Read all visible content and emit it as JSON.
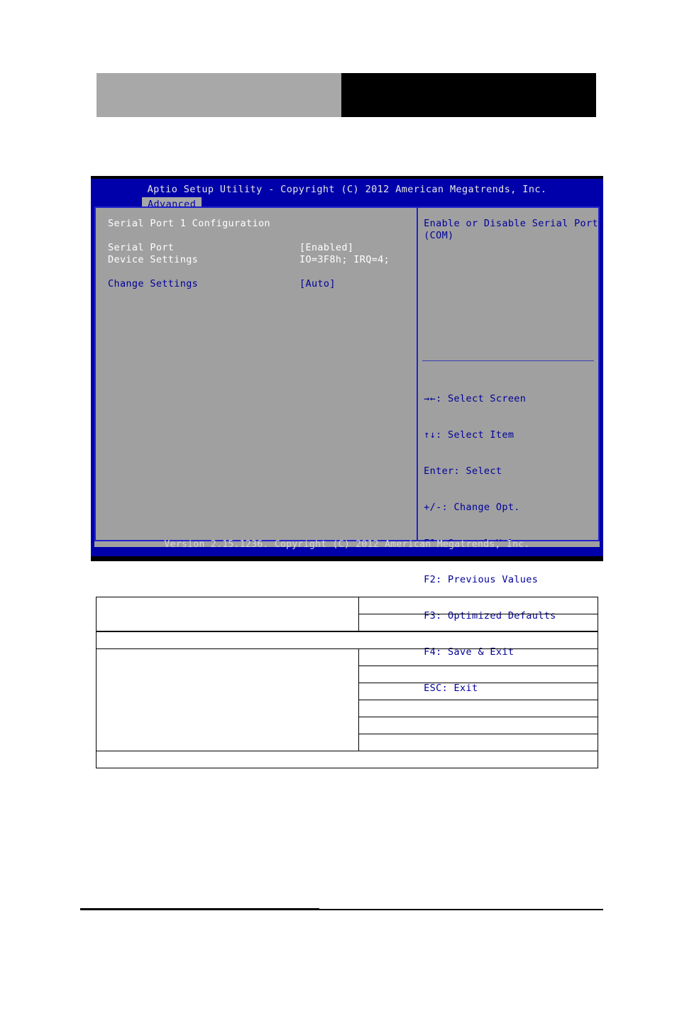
{
  "page": {
    "header_blocks": [
      {
        "name": "left-block",
        "color": "#a8a8a8",
        "text": ""
      },
      {
        "name": "right-block",
        "color": "#000000",
        "text": ""
      }
    ]
  },
  "bios": {
    "title": "Aptio Setup Utility - Copyright (C) 2012 American Megatrends, Inc.",
    "tabs": [
      {
        "label": "Advanced",
        "active": true
      }
    ],
    "section_title": "Serial Port 1 Configuration",
    "settings": [
      {
        "label": "Serial Port",
        "value": "[Enabled]",
        "style": "white",
        "selected": true
      },
      {
        "label": "Device Settings",
        "value": "IO=3F8h; IRQ=4;",
        "style": "white",
        "selected": false
      },
      {
        "label": "",
        "value": "",
        "style": "spacer",
        "selected": false
      },
      {
        "label": "Change Settings",
        "value": "[Auto]",
        "style": "blue",
        "selected": false
      }
    ],
    "help": {
      "line1": "Enable or Disable Serial Port",
      "line2": "(COM)"
    },
    "keys": [
      "→←: Select Screen",
      "↑↓: Select Item",
      "Enter: Select",
      "+/-: Change Opt.",
      "F1: General Help",
      "F2: Previous Values",
      "F3: Optimized Defaults",
      "F4: Save & Exit",
      "ESC: Exit"
    ],
    "footer": "Version 2.15.1236. Copyright (C) 2012 American Megatrends, Inc.",
    "colors": {
      "screen_blue": "#0000aa",
      "panel_gray": "#a0a0a0",
      "border_blue": "#2222cc",
      "text_white": "#ffffff",
      "text_blue": "#000099"
    }
  },
  "spec_table": {
    "rows": [
      {
        "cells": [
          "",
          ""
        ]
      },
      {
        "cells": [
          "",
          ""
        ]
      },
      {
        "cells": [
          ""
        ],
        "span": 2
      },
      {
        "cells": [
          "",
          ""
        ]
      },
      {
        "cells": [
          "",
          ""
        ]
      },
      {
        "cells": [
          "",
          ""
        ]
      },
      {
        "cells": [
          "",
          ""
        ]
      },
      {
        "cells": [
          "",
          ""
        ]
      },
      {
        "cells": [
          "",
          ""
        ]
      },
      {
        "cells": [
          ""
        ],
        "span": 2
      }
    ]
  }
}
